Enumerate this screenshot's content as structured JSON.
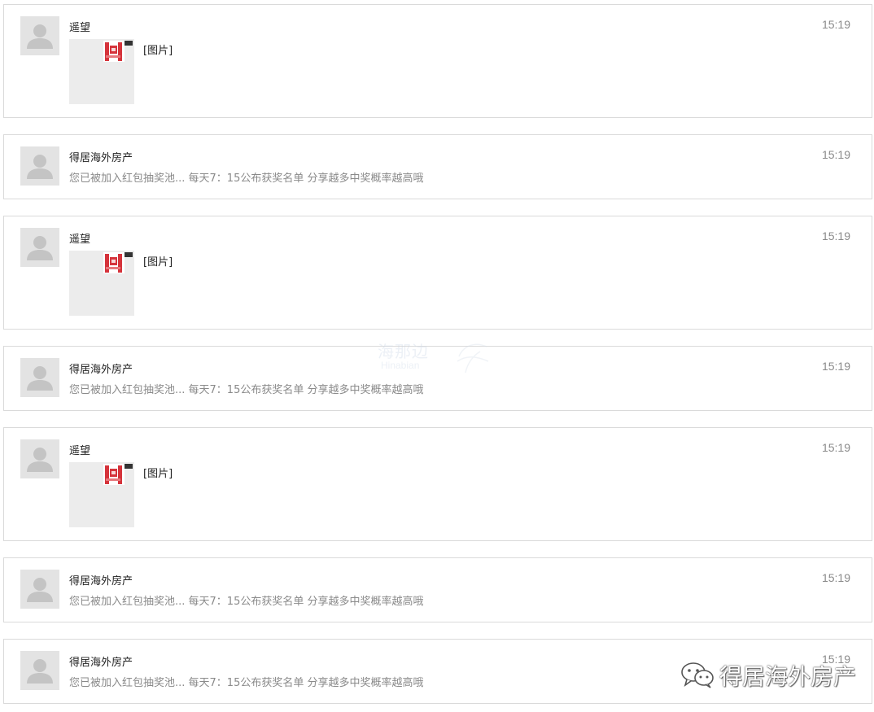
{
  "messages": [
    {
      "sender": "遥望",
      "time": "15:19",
      "image_label": "[图片]"
    },
    {
      "sender": "得居海外房产",
      "time": "15:19",
      "preview": "您已被加入红包抽奖池... 每天7：15公布获奖名单 分享越多中奖概率越高哦"
    },
    {
      "sender": "遥望",
      "time": "15:19",
      "image_label": "[图片]"
    },
    {
      "sender": "得居海外房产",
      "time": "15:19",
      "preview": "您已被加入红包抽奖池... 每天7：15公布获奖名单 分享越多中奖概率越高哦"
    },
    {
      "sender": "遥望",
      "time": "15:19",
      "image_label": "[图片]"
    },
    {
      "sender": "得居海外房产",
      "time": "15:19",
      "preview": "您已被加入红包抽奖池... 每天7：15公布获奖名单 分享越多中奖概率越高哦"
    },
    {
      "sender": "得居海外房产",
      "time": "15:19",
      "preview": "您已被加入红包抽奖池... 每天7：15公布获奖名单 分享越多中奖概率越高哦"
    }
  ],
  "watermarks": {
    "center_cn": "海那边",
    "center_en": "Hinabian",
    "bottom_right": "得居海外房产"
  },
  "icons": {
    "avatar": "default-user-avatar-icon",
    "thumbnail": "red-envelope-poster-thumbnail",
    "wechat": "wechat-icon"
  },
  "colors": {
    "border": "#dadada",
    "avatar_bg": "#e3e3e3",
    "muted_text": "#8a8a8a",
    "thumb_red": "#d5333b"
  }
}
